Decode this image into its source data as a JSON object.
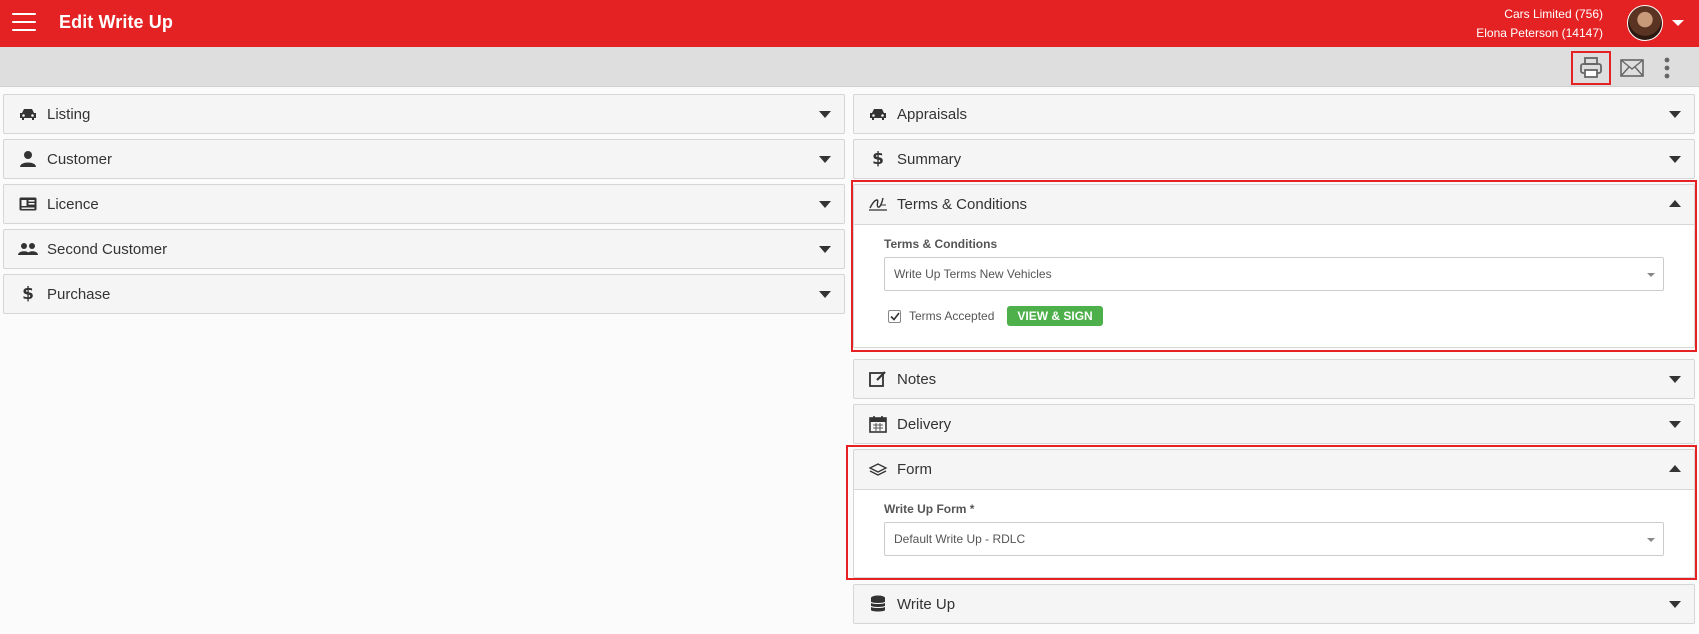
{
  "header": {
    "title": "Edit Write Up",
    "company": "Cars Limited (756)",
    "user": "Elona Peterson (14147)",
    "accent_color": "#e42224"
  },
  "toolbar": {
    "icons": [
      "print-icon",
      "email-icon",
      "more-vertical-icon"
    ]
  },
  "left_panels": [
    {
      "title": "Listing",
      "icon": "car-icon"
    },
    {
      "title": "Customer",
      "icon": "person-icon"
    },
    {
      "title": "Licence",
      "icon": "id-card-icon"
    },
    {
      "title": "Second Customer",
      "icon": "people-icon"
    },
    {
      "title": "Purchase",
      "icon": "dollar-icon"
    }
  ],
  "right_panels": {
    "appraisals": {
      "title": "Appraisals",
      "icon": "car-icon"
    },
    "summary": {
      "title": "Summary",
      "icon": "dollar-icon"
    },
    "terms": {
      "title": "Terms & Conditions",
      "icon": "signature-icon",
      "field_label": "Terms & Conditions",
      "selected": "Write Up Terms New Vehicles",
      "checkbox_label": "Terms Accepted",
      "checkbox_checked": true,
      "button_label": "VIEW & SIGN"
    },
    "notes": {
      "title": "Notes",
      "icon": "edit-note-icon"
    },
    "delivery": {
      "title": "Delivery",
      "icon": "calendar-icon"
    },
    "form": {
      "title": "Form",
      "icon": "layers-icon",
      "field_label": "Write Up Form *",
      "selected": "Default Write Up - RDLC"
    },
    "writeup": {
      "title": "Write Up",
      "icon": "database-icon"
    }
  }
}
